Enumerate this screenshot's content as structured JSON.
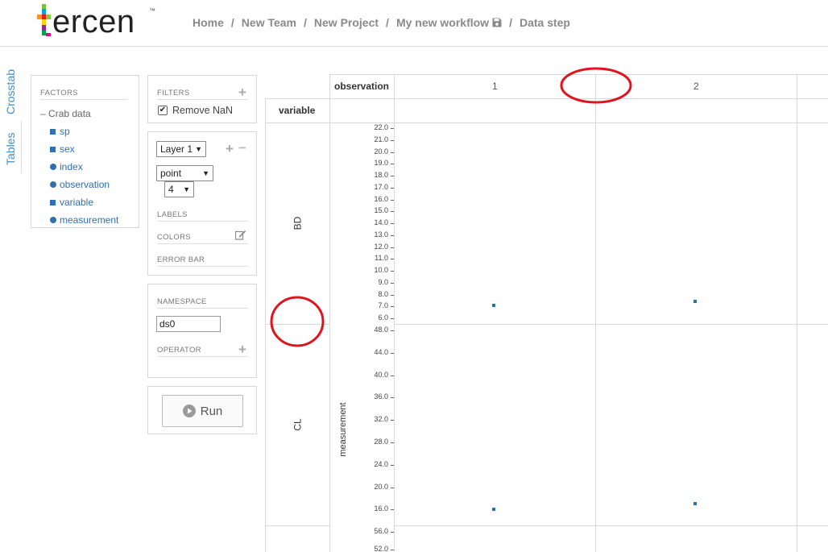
{
  "app": {
    "logo_text": "ercen",
    "logo_tm": "™"
  },
  "breadcrumb": {
    "items": [
      "Home",
      "New Team",
      "New Project",
      "My new workflow",
      "Data step"
    ],
    "separator": "/"
  },
  "side_tabs": {
    "crosstab": "Crosstab",
    "tables": "Tables"
  },
  "factors": {
    "title": "FACTORS",
    "root": "Crab data",
    "items": [
      {
        "label": "sp",
        "icon": "square-icon"
      },
      {
        "label": "sex",
        "icon": "square-icon"
      },
      {
        "label": "index",
        "icon": "circle-icon"
      },
      {
        "label": "observation",
        "icon": "circle-icon"
      },
      {
        "label": "variable",
        "icon": "square-icon"
      },
      {
        "label": "measurement",
        "icon": "circle-icon"
      }
    ]
  },
  "filters": {
    "title": "FILTERS",
    "remove_nan_label": "Remove NaN",
    "remove_nan_checked": true
  },
  "layers": {
    "layer_select": "Layer 1",
    "geom_select": "point",
    "size_select": "4",
    "labels_title": "LABELS",
    "colors_title": "COLORS",
    "error_bar_title": "ERROR BAR"
  },
  "namespace": {
    "title": "NAMESPACE",
    "value": "ds0",
    "operator_title": "OPERATOR"
  },
  "run": {
    "label": "Run"
  },
  "crosstab": {
    "col_factor": "observation",
    "row_factor": "variable",
    "columns": [
      "1",
      "2"
    ],
    "rows": [
      "BD",
      "CL"
    ],
    "y_axis_label": "measurement",
    "bd_ticks": [
      "22.0",
      "21.0",
      "20.0",
      "19.0",
      "18.0",
      "17.0",
      "16.0",
      "15.0",
      "14.0",
      "13.0",
      "12.0",
      "11.0",
      "10.0",
      "9.0",
      "8.0",
      "7.0",
      "6.0"
    ],
    "cl_ticks": [
      "48.0",
      "44.0",
      "40.0",
      "36.0",
      "32.0",
      "28.0",
      "24.0",
      "20.0",
      "16.0"
    ],
    "next_ticks": [
      "56.0",
      "52.0"
    ]
  },
  "chart_data": {
    "type": "scatter",
    "xlabel": "observation",
    "ylabel": "measurement",
    "panels": [
      {
        "row": "BD",
        "points": [
          {
            "observation": "1",
            "measurement": 7.1
          },
          {
            "observation": "2",
            "measurement": 7.4
          }
        ],
        "ylim": [
          6.0,
          22.0
        ]
      },
      {
        "row": "CL",
        "points": [
          {
            "observation": "1",
            "measurement": 16.0
          },
          {
            "observation": "2",
            "measurement": 17.0
          }
        ],
        "ylim": [
          16.0,
          48.0
        ]
      }
    ]
  },
  "colors": {
    "accent": "#3a8fd0",
    "factor_blue": "#2f6fb3",
    "point_blue": "#2c6fad",
    "annotation_red": "#e0141e"
  }
}
